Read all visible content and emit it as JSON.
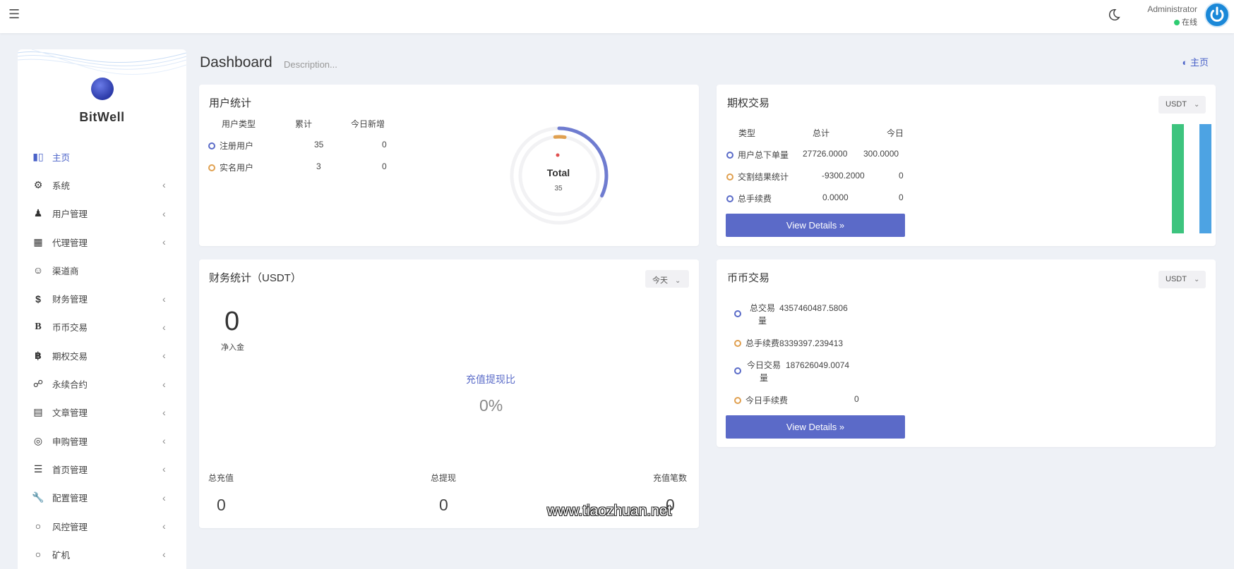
{
  "topbar": {
    "admin_name": "Administrator",
    "admin_status": "在线"
  },
  "sidebar": {
    "brand": "BitWell",
    "items": [
      {
        "label": "主页",
        "icon": "bar-chart-icon",
        "has_children": false,
        "active": true
      },
      {
        "label": "系统",
        "icon": "gear-icon",
        "has_children": true
      },
      {
        "label": "用户管理",
        "icon": "user-tie-icon",
        "has_children": true
      },
      {
        "label": "代理管理",
        "icon": "id-card-icon",
        "has_children": true
      },
      {
        "label": "渠道商",
        "icon": "user-circle-icon",
        "has_children": false
      },
      {
        "label": "财务管理",
        "icon": "dollar-icon",
        "has_children": true
      },
      {
        "label": "币币交易",
        "icon": "bold-b-icon",
        "has_children": true
      },
      {
        "label": "期权交易",
        "icon": "bitcoin-icon",
        "has_children": true
      },
      {
        "label": "永续合约",
        "icon": "link-icon",
        "has_children": true
      },
      {
        "label": "文章管理",
        "icon": "newspaper-icon",
        "has_children": true
      },
      {
        "label": "申购管理",
        "icon": "life-ring-icon",
        "has_children": true
      },
      {
        "label": "首页管理",
        "icon": "list-icon",
        "has_children": true
      },
      {
        "label": "配置管理",
        "icon": "wrench-icon",
        "has_children": true
      },
      {
        "label": "风控管理",
        "icon": "circle-icon",
        "has_children": true
      },
      {
        "label": "矿机",
        "icon": "circle-icon",
        "has_children": true
      }
    ]
  },
  "header": {
    "title": "Dashboard",
    "description": "Description...",
    "breadcrumb": "主页"
  },
  "user_stats": {
    "title": "用户统计",
    "columns": [
      "用户类型",
      "累计",
      "今日新增"
    ],
    "rows": [
      {
        "type": "注册用户",
        "total": "35",
        "today": "0"
      },
      {
        "type": "实名用户",
        "total": "3",
        "today": "0"
      }
    ],
    "donut": {
      "label": "Total",
      "value": "35",
      "registered_fraction": 1.0,
      "verified_fraction": 0.0857
    }
  },
  "options_trade": {
    "title": "期权交易",
    "select": "USDT",
    "columns": [
      "类型",
      "总计",
      "今日"
    ],
    "rows": [
      {
        "label": "用户总下单量",
        "total": "27726.0000",
        "today": "300.0000"
      },
      {
        "label": "交割结果统计",
        "total": "-9300.2000",
        "today": "0"
      },
      {
        "label": "总手续费",
        "total": "0.0000",
        "today": "0"
      }
    ],
    "button": "View Details",
    "bar_colors": [
      "#3dc47e",
      "#4da3e3"
    ]
  },
  "finance": {
    "title": "财务统计（USDT）",
    "select": "今天",
    "net_inflow_value": "0",
    "net_inflow_label": "净入金",
    "ratio_label": "充值提现比",
    "ratio_value": "0%",
    "totals": [
      {
        "label": "总充值",
        "value": "0"
      },
      {
        "label": "总提现",
        "value": "0"
      },
      {
        "label": "充值笔数",
        "value": "0"
      }
    ]
  },
  "spot_trade": {
    "title": "币币交易",
    "select": "USDT",
    "rows": [
      {
        "label_1": "总交易",
        "label_2": "量",
        "value": "4357460487.5806",
        "color": "#5a6bc8"
      },
      {
        "label_1": "总手续费",
        "label_2": "",
        "value": "8339397.239413",
        "color": "#e0a050"
      },
      {
        "label_1": "今日交易",
        "label_2": "量",
        "value": "187626049.0074",
        "color": "#5a6bc8"
      },
      {
        "label_1": "今日手续费",
        "label_2": "",
        "value": "0",
        "color": "#e0a050"
      }
    ],
    "button": "View Details"
  },
  "watermark": "www.tiaozhuan.net"
}
